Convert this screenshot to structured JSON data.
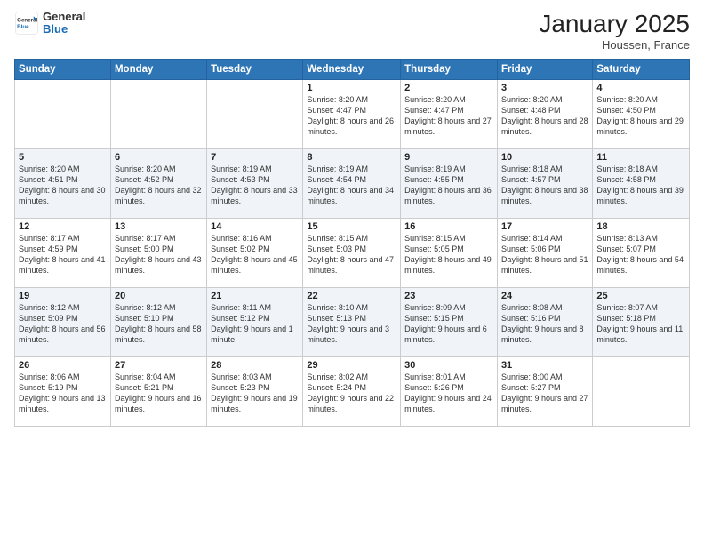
{
  "logo": {
    "general": "General",
    "blue": "Blue"
  },
  "header": {
    "month": "January 2025",
    "location": "Houssen, France"
  },
  "weekdays": [
    "Sunday",
    "Monday",
    "Tuesday",
    "Wednesday",
    "Thursday",
    "Friday",
    "Saturday"
  ],
  "weeks": [
    [
      {
        "day": "",
        "info": ""
      },
      {
        "day": "",
        "info": ""
      },
      {
        "day": "",
        "info": ""
      },
      {
        "day": "1",
        "info": "Sunrise: 8:20 AM\nSunset: 4:47 PM\nDaylight: 8 hours\nand 26 minutes."
      },
      {
        "day": "2",
        "info": "Sunrise: 8:20 AM\nSunset: 4:47 PM\nDaylight: 8 hours\nand 27 minutes."
      },
      {
        "day": "3",
        "info": "Sunrise: 8:20 AM\nSunset: 4:48 PM\nDaylight: 8 hours\nand 28 minutes."
      },
      {
        "day": "4",
        "info": "Sunrise: 8:20 AM\nSunset: 4:50 PM\nDaylight: 8 hours\nand 29 minutes."
      }
    ],
    [
      {
        "day": "5",
        "info": "Sunrise: 8:20 AM\nSunset: 4:51 PM\nDaylight: 8 hours\nand 30 minutes."
      },
      {
        "day": "6",
        "info": "Sunrise: 8:20 AM\nSunset: 4:52 PM\nDaylight: 8 hours\nand 32 minutes."
      },
      {
        "day": "7",
        "info": "Sunrise: 8:19 AM\nSunset: 4:53 PM\nDaylight: 8 hours\nand 33 minutes."
      },
      {
        "day": "8",
        "info": "Sunrise: 8:19 AM\nSunset: 4:54 PM\nDaylight: 8 hours\nand 34 minutes."
      },
      {
        "day": "9",
        "info": "Sunrise: 8:19 AM\nSunset: 4:55 PM\nDaylight: 8 hours\nand 36 minutes."
      },
      {
        "day": "10",
        "info": "Sunrise: 8:18 AM\nSunset: 4:57 PM\nDaylight: 8 hours\nand 38 minutes."
      },
      {
        "day": "11",
        "info": "Sunrise: 8:18 AM\nSunset: 4:58 PM\nDaylight: 8 hours\nand 39 minutes."
      }
    ],
    [
      {
        "day": "12",
        "info": "Sunrise: 8:17 AM\nSunset: 4:59 PM\nDaylight: 8 hours\nand 41 minutes."
      },
      {
        "day": "13",
        "info": "Sunrise: 8:17 AM\nSunset: 5:00 PM\nDaylight: 8 hours\nand 43 minutes."
      },
      {
        "day": "14",
        "info": "Sunrise: 8:16 AM\nSunset: 5:02 PM\nDaylight: 8 hours\nand 45 minutes."
      },
      {
        "day": "15",
        "info": "Sunrise: 8:15 AM\nSunset: 5:03 PM\nDaylight: 8 hours\nand 47 minutes."
      },
      {
        "day": "16",
        "info": "Sunrise: 8:15 AM\nSunset: 5:05 PM\nDaylight: 8 hours\nand 49 minutes."
      },
      {
        "day": "17",
        "info": "Sunrise: 8:14 AM\nSunset: 5:06 PM\nDaylight: 8 hours\nand 51 minutes."
      },
      {
        "day": "18",
        "info": "Sunrise: 8:13 AM\nSunset: 5:07 PM\nDaylight: 8 hours\nand 54 minutes."
      }
    ],
    [
      {
        "day": "19",
        "info": "Sunrise: 8:12 AM\nSunset: 5:09 PM\nDaylight: 8 hours\nand 56 minutes."
      },
      {
        "day": "20",
        "info": "Sunrise: 8:12 AM\nSunset: 5:10 PM\nDaylight: 8 hours\nand 58 minutes."
      },
      {
        "day": "21",
        "info": "Sunrise: 8:11 AM\nSunset: 5:12 PM\nDaylight: 9 hours\nand 1 minute."
      },
      {
        "day": "22",
        "info": "Sunrise: 8:10 AM\nSunset: 5:13 PM\nDaylight: 9 hours\nand 3 minutes."
      },
      {
        "day": "23",
        "info": "Sunrise: 8:09 AM\nSunset: 5:15 PM\nDaylight: 9 hours\nand 6 minutes."
      },
      {
        "day": "24",
        "info": "Sunrise: 8:08 AM\nSunset: 5:16 PM\nDaylight: 9 hours\nand 8 minutes."
      },
      {
        "day": "25",
        "info": "Sunrise: 8:07 AM\nSunset: 5:18 PM\nDaylight: 9 hours\nand 11 minutes."
      }
    ],
    [
      {
        "day": "26",
        "info": "Sunrise: 8:06 AM\nSunset: 5:19 PM\nDaylight: 9 hours\nand 13 minutes."
      },
      {
        "day": "27",
        "info": "Sunrise: 8:04 AM\nSunset: 5:21 PM\nDaylight: 9 hours\nand 16 minutes."
      },
      {
        "day": "28",
        "info": "Sunrise: 8:03 AM\nSunset: 5:23 PM\nDaylight: 9 hours\nand 19 minutes."
      },
      {
        "day": "29",
        "info": "Sunrise: 8:02 AM\nSunset: 5:24 PM\nDaylight: 9 hours\nand 22 minutes."
      },
      {
        "day": "30",
        "info": "Sunrise: 8:01 AM\nSunset: 5:26 PM\nDaylight: 9 hours\nand 24 minutes."
      },
      {
        "day": "31",
        "info": "Sunrise: 8:00 AM\nSunset: 5:27 PM\nDaylight: 9 hours\nand 27 minutes."
      },
      {
        "day": "",
        "info": ""
      }
    ]
  ]
}
